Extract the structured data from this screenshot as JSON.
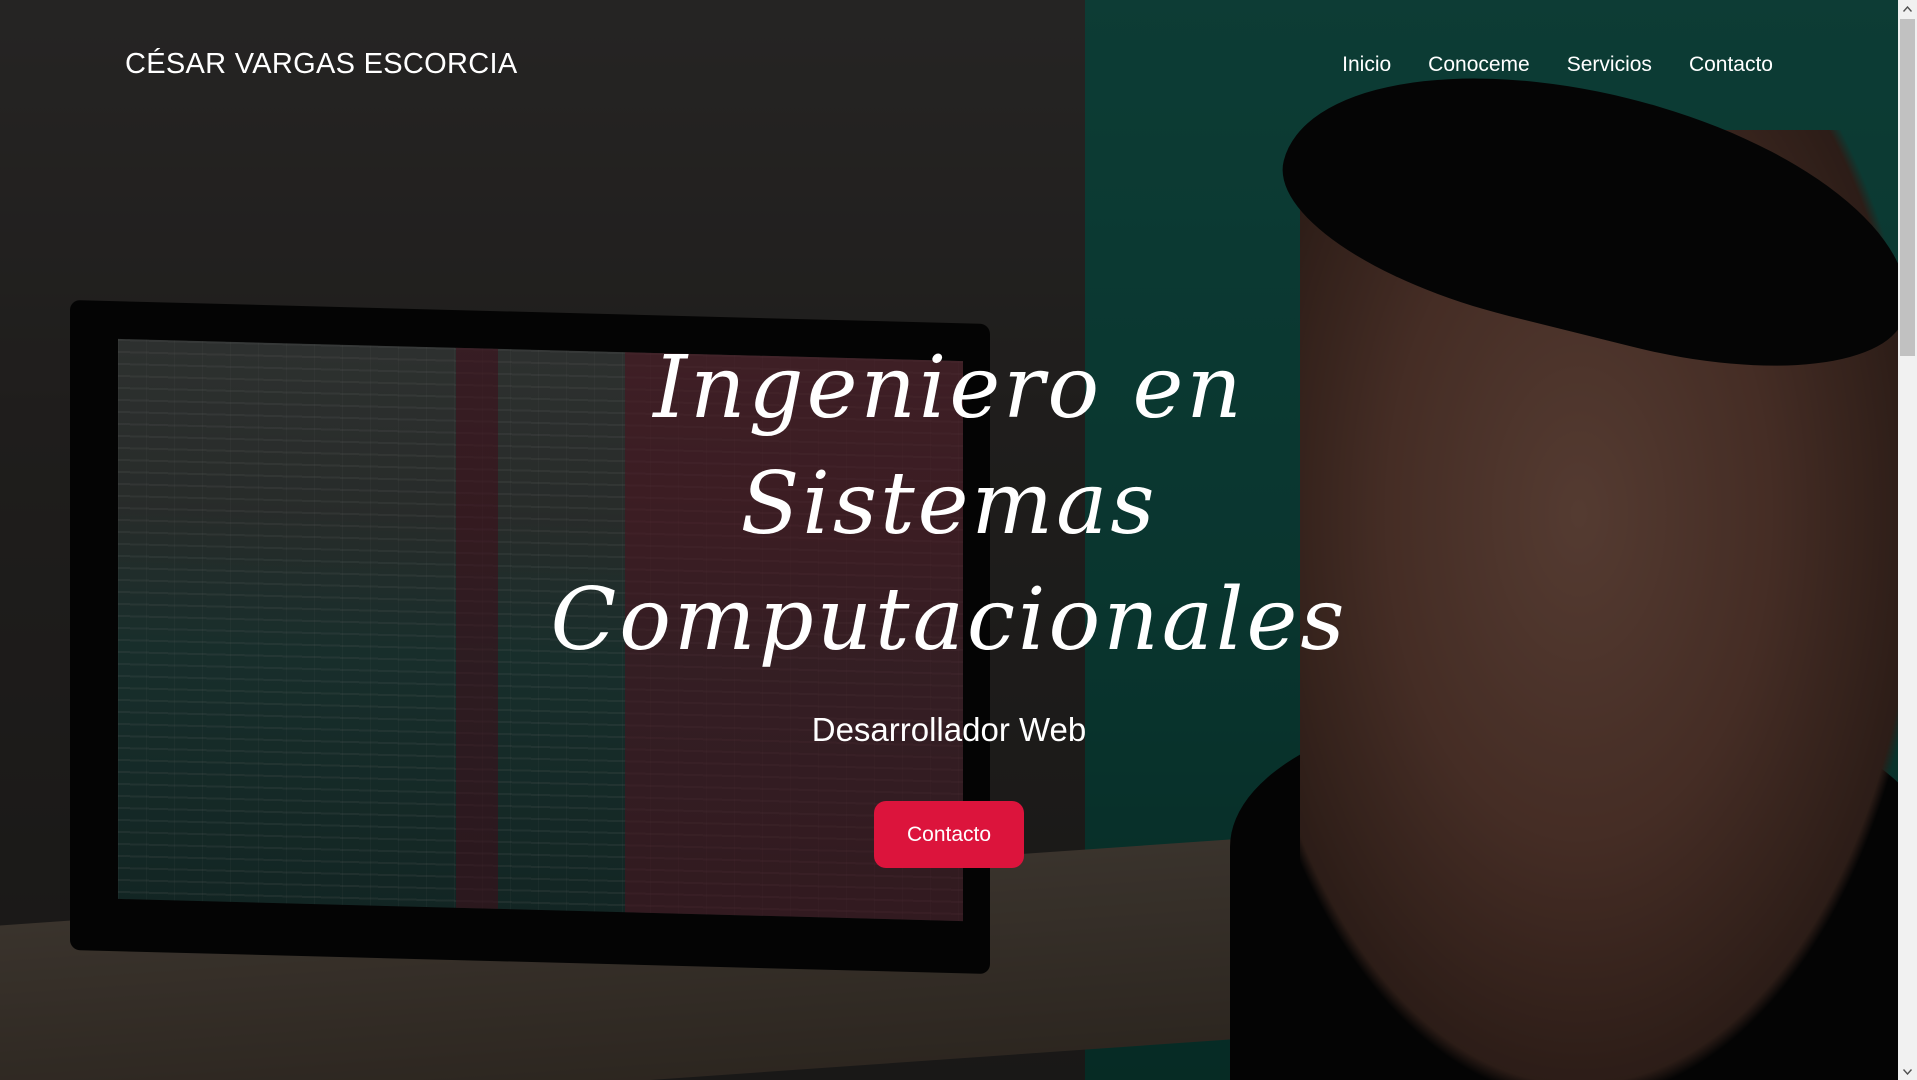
{
  "brand": {
    "name": "CÉSAR VARGAS ESCORCIA"
  },
  "nav": {
    "items": [
      {
        "label": "Inicio"
      },
      {
        "label": "Conoceme"
      },
      {
        "label": "Servicios"
      },
      {
        "label": "Contacto"
      }
    ]
  },
  "hero": {
    "title_line1": "Ingeniero en Sistemas",
    "title_line2": "Computacionales",
    "subtitle": "Desarrollador Web",
    "button_label": "Contacto"
  },
  "theme": {
    "accent": "#dc143c",
    "overlay": "rgba(0,0,0,0.58)"
  },
  "icons": {
    "scroll_up": "chevron-up-icon",
    "scroll_down": "chevron-down-icon"
  }
}
